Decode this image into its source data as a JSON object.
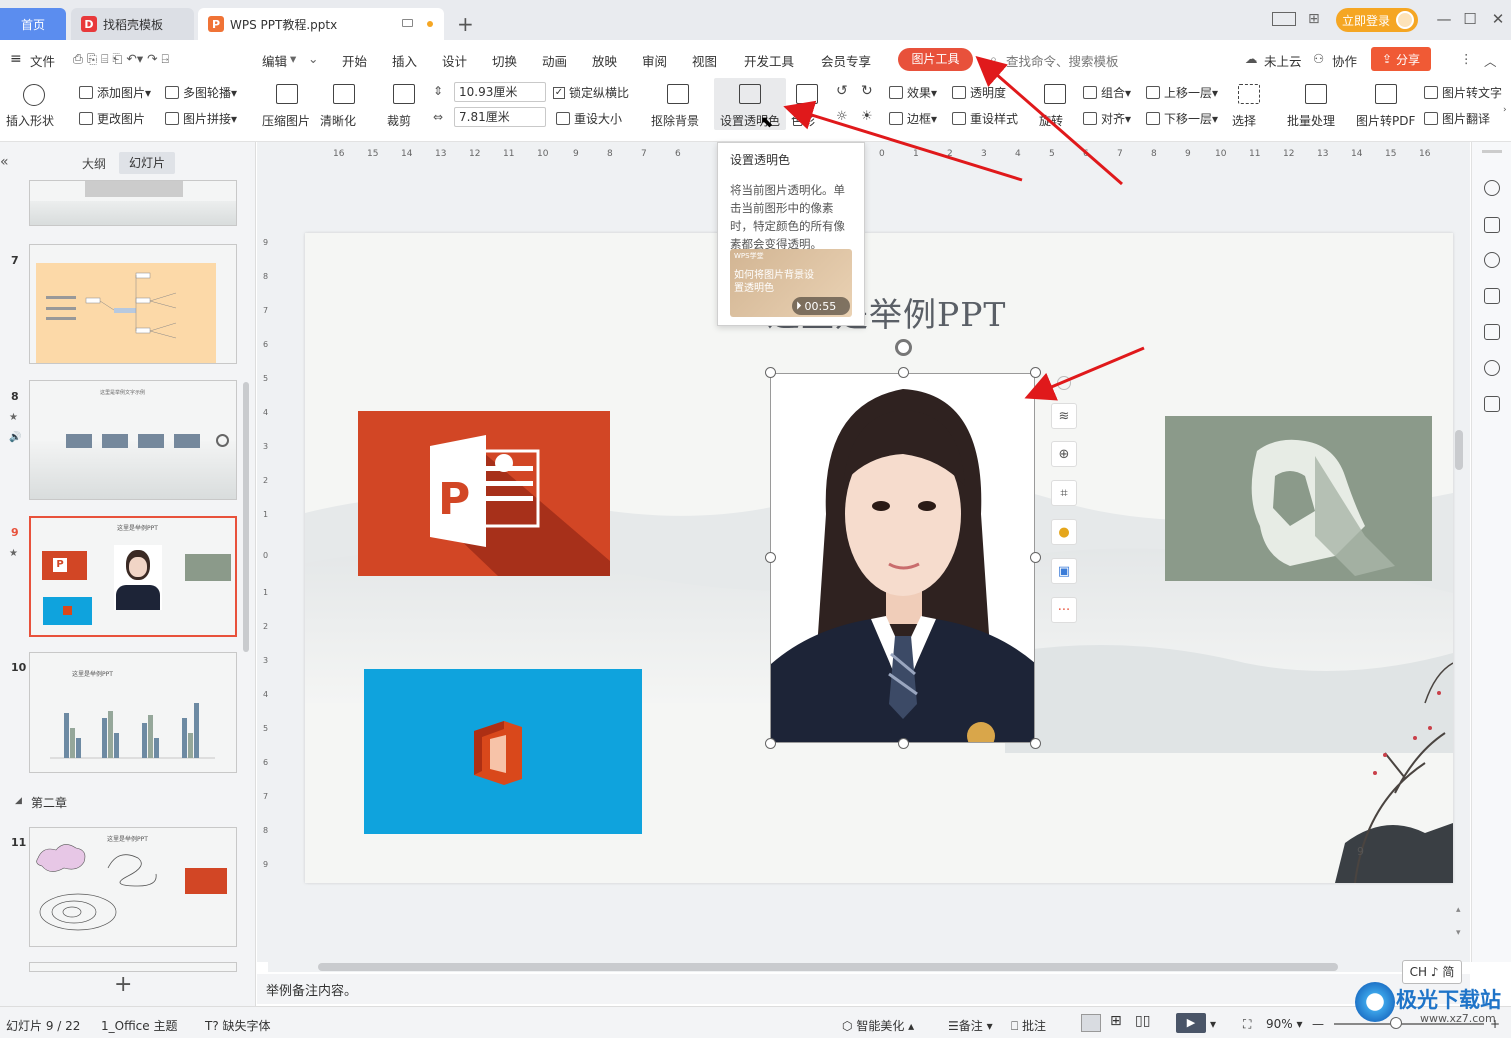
{
  "titlebar": {
    "tab_home": "首页",
    "tab_template": "找稻壳模板",
    "tab_doc": "WPS PPT教程.pptx",
    "login_label": "立即登录"
  },
  "menubar": {
    "file": "文件",
    "edit": "编辑",
    "items": [
      "开始",
      "插入",
      "设计",
      "切换",
      "动画",
      "放映",
      "审阅",
      "视图",
      "开发工具",
      "会员专享"
    ],
    "picture_tools": "图片工具",
    "search_placeholder": "查找命令、搜索模板",
    "cloud": "未上云",
    "collab": "协作",
    "share": "分享"
  },
  "ribbon": {
    "insert_shape": "插入形状",
    "add_picture": "添加图片",
    "multi_carousel": "多图轮播",
    "change_picture": "更改图片",
    "picture_collage": "图片拼接",
    "compress": "压缩图片",
    "sharpen": "清晰化",
    "crop": "裁剪",
    "height_value": "10.93厘米",
    "width_value": "7.81厘米",
    "lock_ratio": "锁定纵横比",
    "reset_size": "重设大小",
    "remove_bg": "抠除背景",
    "set_transparent": "设置透明色",
    "color": "色彩",
    "effects": "效果",
    "transparency": "透明度",
    "border": "边框",
    "reset_style": "重设样式",
    "rotate": "旋转",
    "group": "组合",
    "align": "对齐",
    "bring_forward": "上移一层",
    "send_backward": "下移一层",
    "select": "选择",
    "batch": "批量处理",
    "to_pdf": "图片转PDF",
    "to_text": "图片转文字",
    "translate": "图片翻译"
  },
  "leftpanel": {
    "tab_outline": "大纲",
    "tab_slides": "幻灯片",
    "slide_numbers": [
      "7",
      "8",
      "9",
      "10",
      "11"
    ],
    "section_label": "第二章",
    "thumb_titles": {
      "s8": "这里是举例文字示例",
      "s9": "这里是举例PPT",
      "s10": "这里是举例PPT",
      "s11": "这里是举例PPT"
    }
  },
  "tooltip": {
    "title": "设置透明色",
    "body": "将当前图片透明化。单击当前图形中的像素时，特定颜色的所有像素都会变得透明。",
    "video_brand": "WPS学堂",
    "video_title": "如何将图片背景设置透明色",
    "video_duration": "00:55"
  },
  "slide": {
    "title": "这里是举例PPT",
    "page_number": "9"
  },
  "notes_text": "举例备注内容。",
  "ime": "CH ♪ 简",
  "statusbar": {
    "slide_info": "幻灯片 9 / 22",
    "theme": "1_Office 主题",
    "missing_font": "缺失字体",
    "beautify": "智能美化",
    "notes": "备注",
    "comments": "批注",
    "zoom": "90%"
  },
  "watermark": {
    "brand": "极光下载站",
    "url": "www.xz7.com"
  },
  "colors": {
    "accent_blue": "#5b8def",
    "picture_tools_red": "#e8513b",
    "share_orange": "#f05a35",
    "login_orange": "#f5a623",
    "ppt_red": "#d24625",
    "office_blue": "#0fa3dd",
    "sage_gray": "#8b9a8a",
    "arrow_red": "#e0191b"
  }
}
